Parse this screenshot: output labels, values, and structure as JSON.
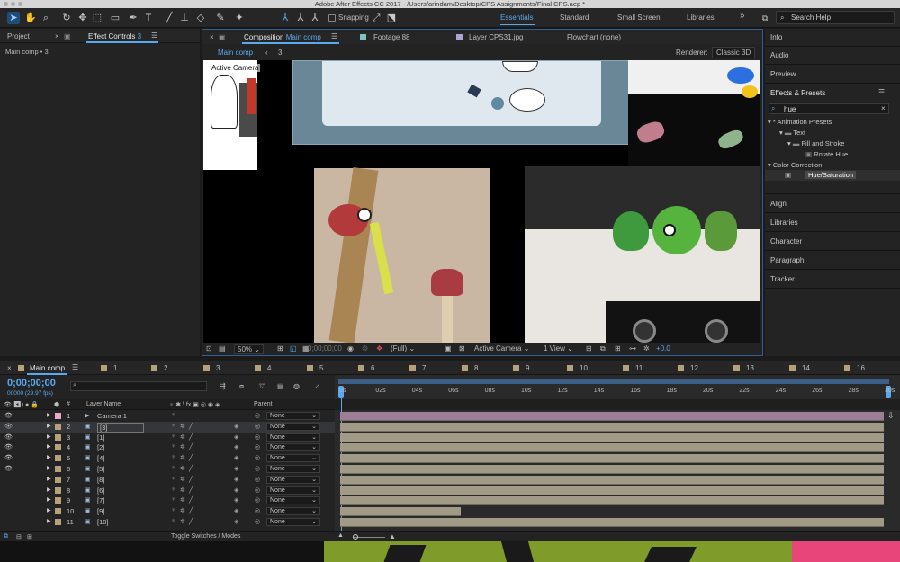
{
  "app": {
    "window_title": "Adobe After Effects CC 2017 - /Users/arindam/Desktop/CPS Assignments/Final CPS.aep *"
  },
  "toolbar": {
    "snapping_label": "Snapping",
    "workspaces": [
      "Essentials",
      "Standard",
      "Small Screen",
      "Libraries"
    ],
    "overflow": "»",
    "help_placeholder": "Search Help"
  },
  "left_panel": {
    "tab_project": "Project",
    "tab_effect_controls_prefix": "Effect Controls",
    "tab_effect_controls_suffix": "3",
    "breadcrumb": "Main comp • 3"
  },
  "composition": {
    "tab_prefix": "Composition",
    "tab_name": "Main comp",
    "footage_tab": "Footage 88",
    "layer_tab": "Layer CPS31.jpg",
    "flowchart_tab": "Flowchart (none)",
    "crumb_main": "Main comp",
    "crumb_child": "3",
    "renderer_label": "Renderer:",
    "renderer_value": "Classic 3D",
    "active_camera_overlay": "Active Camera",
    "zoom": "50%",
    "timecode": "0;00;00;00",
    "resolution": "(Full)",
    "view": "Active Camera",
    "views": "1 View",
    "exposure": "+0.0"
  },
  "right_panel": {
    "info": "Info",
    "audio": "Audio",
    "preview": "Preview",
    "effects_presets": "Effects & Presets",
    "search_value": "hue",
    "tree": [
      "* Animation Presets",
      "Text",
      "Fill and Stroke",
      "Rotate Hue",
      "Color Correction",
      "Hue/Saturation"
    ],
    "align": "Align",
    "libraries": "Libraries",
    "character": "Character",
    "paragraph": "Paragraph",
    "tracker": "Tracker"
  },
  "timeline": {
    "tab_name": "Main comp",
    "other_tabs": [
      "1",
      "2",
      "3",
      "4",
      "5",
      "6",
      "7",
      "8",
      "9",
      "10",
      "11",
      "12",
      "13",
      "14",
      "16"
    ],
    "timecode": "0;00;00;00",
    "fps": "00000 (29.97 fps)",
    "search_placeholder": "",
    "col_hash": "#",
    "col_layer_name": "Layer Name",
    "col_switches": "♀ ✱ \\ fx ▣ ◎ ◉ ◈",
    "col_parent": "Parent",
    "ruler": [
      "0s",
      "02s",
      "04s",
      "06s",
      "08s",
      "10s",
      "12s",
      "14s",
      "16s",
      "18s",
      "20s",
      "22s",
      "24s",
      "26s",
      "28s",
      "30s"
    ],
    "layers": [
      {
        "num": "1",
        "name": "Camera 1",
        "parent": "None"
      },
      {
        "num": "2",
        "name": "[3]",
        "parent": "None"
      },
      {
        "num": "3",
        "name": "[1]",
        "parent": "None"
      },
      {
        "num": "4",
        "name": "[2]",
        "parent": "None"
      },
      {
        "num": "5",
        "name": "[4]",
        "parent": "None"
      },
      {
        "num": "6",
        "name": "[5]",
        "parent": "None"
      },
      {
        "num": "7",
        "name": "[8]",
        "parent": "None"
      },
      {
        "num": "8",
        "name": "[6]",
        "parent": "None"
      },
      {
        "num": "9",
        "name": "[7]",
        "parent": "None"
      },
      {
        "num": "10",
        "name": "[9]",
        "parent": "None"
      },
      {
        "num": "11",
        "name": "[10]",
        "parent": "None"
      }
    ],
    "toggle_label": "Toggle Switches / Modes"
  },
  "colors": {
    "accent_blue": "#5aa9ef",
    "camera_bar": "#9c7f96",
    "layer_bar": "#a09a86",
    "label_tan": "#b8a07a"
  }
}
